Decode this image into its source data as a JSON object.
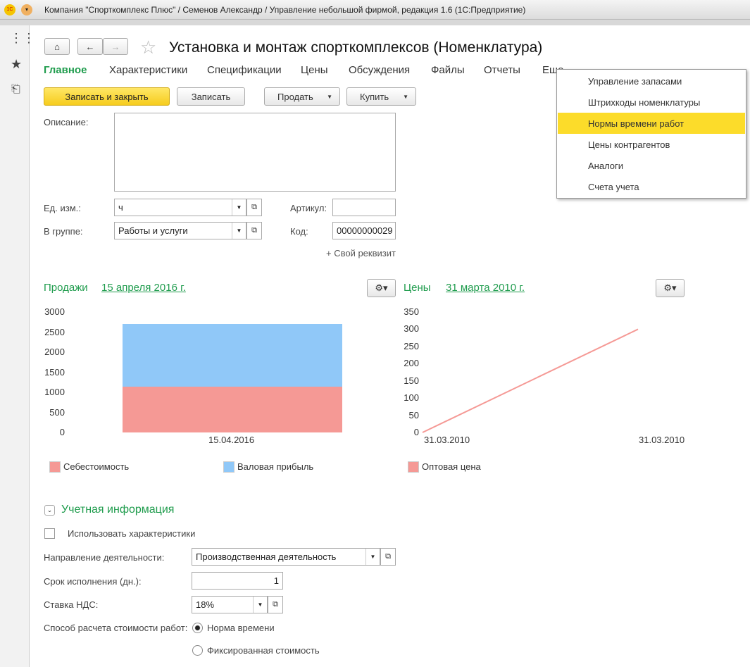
{
  "window_title": "Компания \"Спорткомплекс Плюс\" / Семенов Александр / Управление небольшой фирмой, редакция 1.6  (1С:Предприятие)",
  "page_title": "Установка и монтаж спорткомплексов (Номенклатура)",
  "tabs": [
    "Главное",
    "Характеристики",
    "Спецификации",
    "Цены",
    "Обсуждения",
    "Файлы",
    "Отчеты",
    "Еще"
  ],
  "toolbar": {
    "save_close": "Записать и закрыть",
    "save": "Записать",
    "sell": "Продать",
    "buy": "Купить"
  },
  "menu": {
    "items": [
      "Управление запасами",
      "Штрихкоды номенклатуры",
      "Нормы времени работ",
      "Цены контрагентов",
      "Аналоги",
      "Счета учета"
    ],
    "selected": 2
  },
  "form": {
    "description_label": "Описание:",
    "description_value": "",
    "unit_label": "Ед. изм.:",
    "unit_value": "ч",
    "group_label": "В группе:",
    "group_value": "Работы и услуги",
    "article_label": "Артикул:",
    "article_value": "",
    "code_label": "Код:",
    "code_value": "00000000029",
    "custom_attr": "+ Свой реквизит"
  },
  "sales": {
    "title": "Продажи",
    "date": "15 апреля 2016 г."
  },
  "prices": {
    "title": "Цены",
    "date": "31 марта 2010 г."
  },
  "chart_data": [
    {
      "type": "bar",
      "stacked": true,
      "categories": [
        "15.04.2016"
      ],
      "series": [
        {
          "name": "Себестоимость",
          "values": [
            1140
          ],
          "color": "#f59995"
        },
        {
          "name": "Валовая прибыль",
          "values": [
            1560
          ],
          "color": "#90c8f8"
        }
      ],
      "ylim": [
        0,
        3000
      ],
      "yticks": [
        "3000",
        "2500",
        "2000",
        "1500",
        "1000",
        "500",
        "0"
      ]
    },
    {
      "type": "line",
      "x": [
        "31.03.2010",
        "31.03.2010"
      ],
      "series": [
        {
          "name": "Оптовая цена",
          "values": [
            0,
            300
          ],
          "color": "#f59995"
        }
      ],
      "ylim": [
        0,
        350
      ],
      "yticks": [
        "350",
        "300",
        "250",
        "200",
        "150",
        "100",
        "50",
        "0"
      ]
    }
  ],
  "accounting": {
    "title": "Учетная информация",
    "use_chars": "Использовать характеристики",
    "direction_label": "Направление деятельности:",
    "direction_value": "Производственная деятельность",
    "term_label": "Срок исполнения (дн.):",
    "term_value": "1",
    "vat_label": "Ставка НДС:",
    "vat_value": "18%",
    "calc_label": "Способ расчета стоимости работ:",
    "calc_options": [
      "Норма времени",
      "Фиксированная стоимость"
    ],
    "calc_selected": 0
  }
}
